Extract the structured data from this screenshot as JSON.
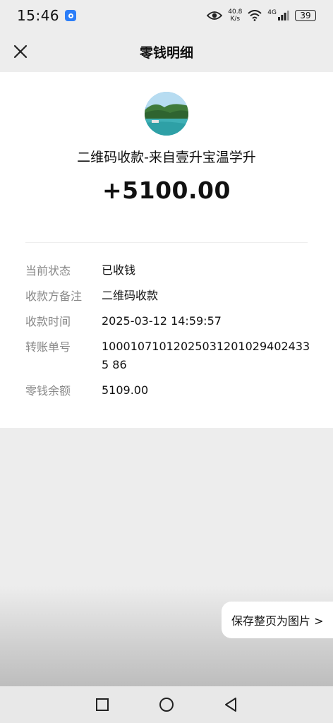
{
  "status_bar": {
    "time": "15:46",
    "net_speed_value": "40.8",
    "net_speed_unit": "K/s",
    "network_type": "4G",
    "battery": "39"
  },
  "nav": {
    "title": "零钱明细",
    "close_icon": "close-icon"
  },
  "transaction": {
    "payee": "二维码收款-来自壹升宝温学升",
    "amount": "+5100.00",
    "details": [
      {
        "label": "当前状态",
        "value": "已收钱"
      },
      {
        "label": "收款方备注",
        "value": "二维码收款"
      },
      {
        "label": "收款时间",
        "value": "2025-03-12 14:59:57"
      },
      {
        "label": "转账单号",
        "value": "100010710120250312010294024335 86"
      },
      {
        "label": "零钱余额",
        "value": "5109.00"
      }
    ]
  },
  "actions": {
    "save_page_label": "保存整页为图片 >"
  },
  "system_nav": {
    "icons": [
      "recents-square-icon",
      "home-circle-icon",
      "back-triangle-icon"
    ]
  }
}
